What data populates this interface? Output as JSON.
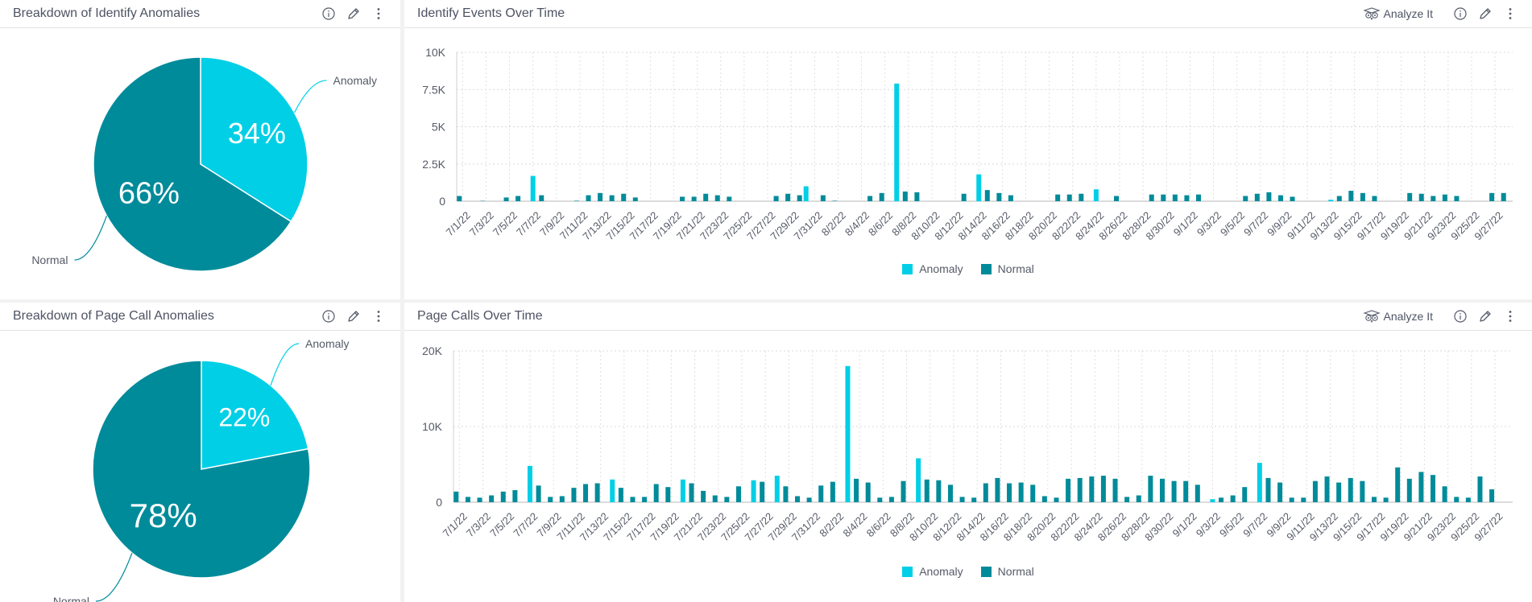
{
  "colors": {
    "anomaly": "#00cfe6",
    "normal": "#008b9a"
  },
  "panels": {
    "identify_pie": {
      "title": "Breakdown of Identify Anomalies"
    },
    "identify_bar": {
      "title": "Identify Events Over Time",
      "analyze_label": "Analyze It"
    },
    "page_pie": {
      "title": "Breakdown of Page Call Anomalies"
    },
    "page_bar": {
      "title": "Page Calls Over Time",
      "analyze_label": "Analyze It"
    }
  },
  "legend": {
    "anomaly": "Anomaly",
    "normal": "Normal"
  },
  "chart_data": [
    {
      "id": "identify_pie",
      "type": "pie",
      "title": "Breakdown of Identify Anomalies",
      "slices": [
        {
          "label": "Anomaly",
          "value": 34,
          "display": "34%"
        },
        {
          "label": "Normal",
          "value": 66,
          "display": "66%"
        }
      ]
    },
    {
      "id": "identify_bar",
      "type": "bar",
      "title": "Identify Events Over Time",
      "xlabel": "",
      "ylabel": "",
      "ylim": [
        0,
        10000
      ],
      "yticks": [
        0,
        2500,
        5000,
        7500,
        10000
      ],
      "ytick_labels": [
        "0",
        "2.5K",
        "5K",
        "7.5K",
        "10K"
      ],
      "grid": true,
      "legend_position": "bottom",
      "start_date": "7/1/22",
      "days": 90,
      "series": [
        {
          "name": "Normal",
          "values": [
            350,
            0,
            20,
            0,
            250,
            350,
            0,
            400,
            0,
            0,
            30,
            400,
            550,
            400,
            500,
            250,
            0,
            0,
            0,
            300,
            300,
            500,
            400,
            300,
            0,
            0,
            0,
            350,
            500,
            400,
            0,
            400,
            30,
            0,
            0,
            350,
            550,
            0,
            650,
            600,
            0,
            0,
            0,
            500,
            0,
            750,
            550,
            400,
            0,
            0,
            0,
            450,
            450,
            500,
            0,
            0,
            350,
            0,
            0,
            450,
            450,
            450,
            400,
            450,
            0,
            0,
            0,
            350,
            500,
            600,
            400,
            300,
            0,
            0,
            0,
            350,
            700,
            550,
            350,
            0,
            0,
            550,
            500,
            350,
            450,
            350,
            0,
            0,
            550,
            550
          ]
        },
        {
          "name": "Anomaly",
          "values": [
            0,
            0,
            0,
            0,
            0,
            0,
            1700,
            0,
            0,
            0,
            0,
            0,
            0,
            0,
            0,
            0,
            0,
            0,
            0,
            0,
            0,
            0,
            0,
            0,
            0,
            0,
            0,
            0,
            0,
            1000,
            0,
            0,
            0,
            0,
            0,
            0,
            0,
            7900,
            0,
            0,
            0,
            0,
            0,
            0,
            1800,
            0,
            0,
            0,
            0,
            0,
            0,
            0,
            0,
            0,
            800,
            0,
            0,
            0,
            0,
            0,
            0,
            0,
            0,
            0,
            0,
            0,
            0,
            0,
            0,
            0,
            0,
            0,
            0,
            0,
            100,
            0,
            0,
            0,
            0,
            0,
            0,
            0,
            0,
            0,
            0,
            0,
            0,
            0,
            0,
            0
          ]
        }
      ]
    },
    {
      "id": "page_pie",
      "type": "pie",
      "title": "Breakdown of Page Call Anomalies",
      "slices": [
        {
          "label": "Anomaly",
          "value": 22,
          "display": "22%"
        },
        {
          "label": "Normal",
          "value": 78,
          "display": "78%"
        }
      ]
    },
    {
      "id": "page_bar",
      "type": "bar",
      "title": "Page Calls Over Time",
      "xlabel": "",
      "ylabel": "",
      "ylim": [
        0,
        20000
      ],
      "yticks": [
        0,
        10000,
        20000
      ],
      "ytick_labels": [
        "0",
        "10K",
        "20K"
      ],
      "grid": true,
      "legend_position": "bottom",
      "start_date": "7/1/22",
      "days": 90,
      "series": [
        {
          "name": "Normal",
          "values": [
            1400,
            700,
            600,
            900,
            1400,
            1600,
            0,
            2200,
            700,
            800,
            1900,
            2400,
            2500,
            0,
            1900,
            700,
            700,
            2400,
            2000,
            0,
            2500,
            1500,
            900,
            700,
            2100,
            0,
            2700,
            0,
            2100,
            800,
            600,
            2200,
            2700,
            0,
            3100,
            2600,
            600,
            700,
            2800,
            0,
            3000,
            2900,
            2300,
            700,
            600,
            2500,
            3200,
            2500,
            2600,
            2300,
            800,
            600,
            3100,
            3200,
            3400,
            3500,
            3100,
            700,
            900,
            3500,
            3100,
            2800,
            2800,
            2300,
            0,
            600,
            900,
            2000,
            0,
            3200,
            2600,
            600,
            600,
            2800,
            3400,
            2600,
            3200,
            2800,
            700,
            600,
            4600,
            3100,
            4000,
            3600,
            2100,
            700,
            600,
            3400,
            1700,
            0
          ]
        },
        {
          "name": "Anomaly",
          "values": [
            0,
            0,
            0,
            0,
            0,
            0,
            4800,
            0,
            0,
            0,
            0,
            0,
            0,
            3000,
            0,
            0,
            0,
            0,
            0,
            3000,
            0,
            0,
            0,
            0,
            0,
            2900,
            0,
            3500,
            0,
            0,
            0,
            0,
            0,
            18000,
            0,
            0,
            0,
            0,
            0,
            5800,
            0,
            0,
            0,
            0,
            0,
            0,
            0,
            0,
            0,
            0,
            0,
            0,
            0,
            0,
            0,
            0,
            0,
            0,
            0,
            0,
            0,
            0,
            0,
            0,
            400,
            0,
            0,
            0,
            5200,
            0,
            0,
            0,
            0,
            0,
            0,
            0,
            0,
            0,
            0,
            0,
            0,
            0,
            0,
            0,
            0,
            0,
            0,
            0,
            0,
            0
          ]
        }
      ]
    }
  ]
}
